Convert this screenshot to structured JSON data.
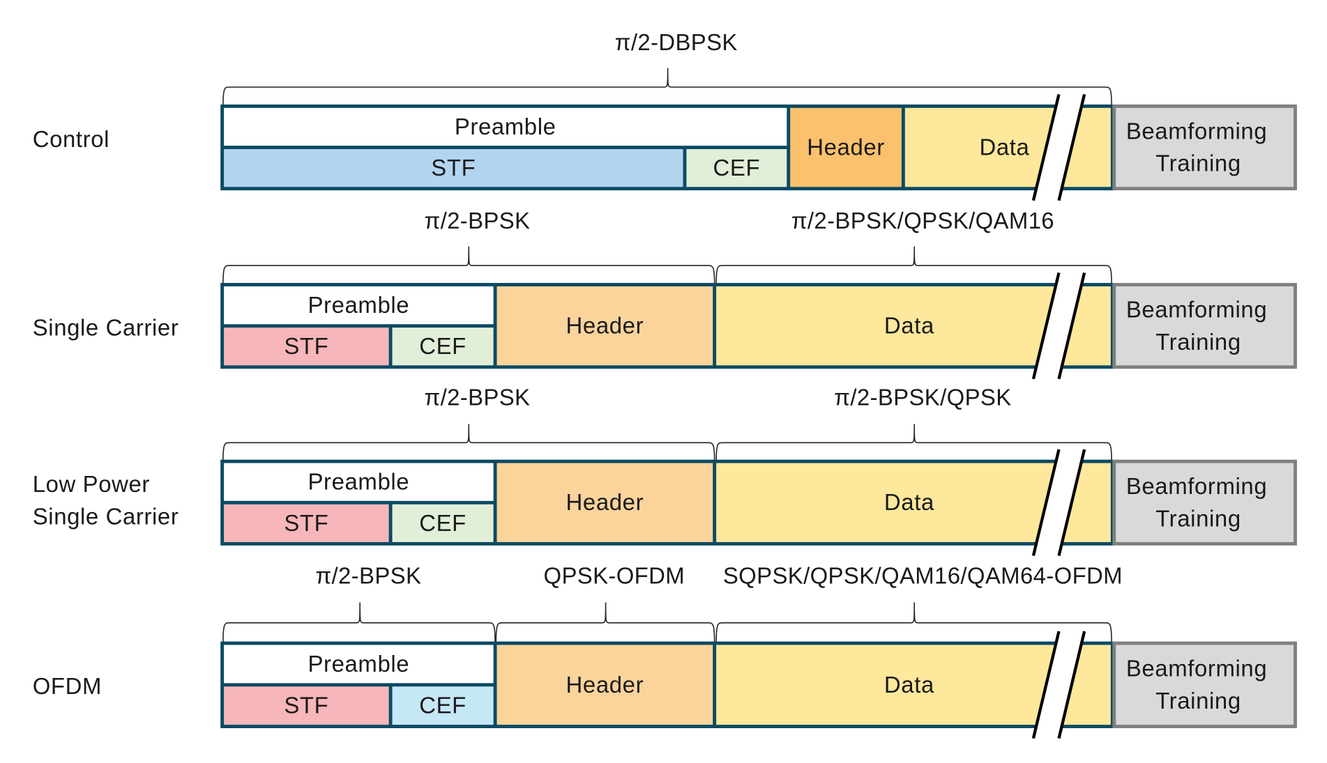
{
  "colors": {
    "frame_border": "#0b4a63",
    "stf_control": "#b3d4ef",
    "stf": "#f7b6b9",
    "cef": "#e2efd8",
    "cef_ofdm": "#c6e7f6",
    "header_control": "#fcc16c",
    "header": "#fbd49b",
    "data": "#fde89b",
    "preamble": "#ffffff",
    "training": "#d9d9d9",
    "training_border": "#808080"
  },
  "rows": [
    {
      "label": [
        "Control"
      ],
      "preamble": "Preamble",
      "stf": "STF",
      "cef": "CEF",
      "header": "Header",
      "data": "Data",
      "training": [
        "Beamforming",
        "Training"
      ],
      "modulations": [
        "π/2-DBPSK"
      ]
    },
    {
      "label": [
        "Single Carrier"
      ],
      "preamble": "Preamble",
      "stf": "STF",
      "cef": "CEF",
      "header": "Header",
      "data": "Data",
      "training": [
        "Beamforming",
        "Training"
      ],
      "modulations": [
        "π/2-BPSK",
        "π/2-BPSK/QPSK/QAM16"
      ]
    },
    {
      "label": [
        "Low Power",
        "Single Carrier"
      ],
      "preamble": "Preamble",
      "stf": "STF",
      "cef": "CEF",
      "header": "Header",
      "data": "Data",
      "training": [
        "Beamforming",
        "Training"
      ],
      "modulations": [
        "π/2-BPSK",
        "π/2-BPSK/QPSK"
      ]
    },
    {
      "label": [
        "OFDM"
      ],
      "preamble": "Preamble",
      "stf": "STF",
      "cef": "CEF",
      "header": "Header",
      "data": "Data",
      "training": [
        "Beamforming",
        "Training"
      ],
      "modulations": [
        "π/2-BPSK",
        "QPSK-OFDM",
        "SQPSK/QPSK/QAM16/QAM64-OFDM"
      ]
    }
  ]
}
